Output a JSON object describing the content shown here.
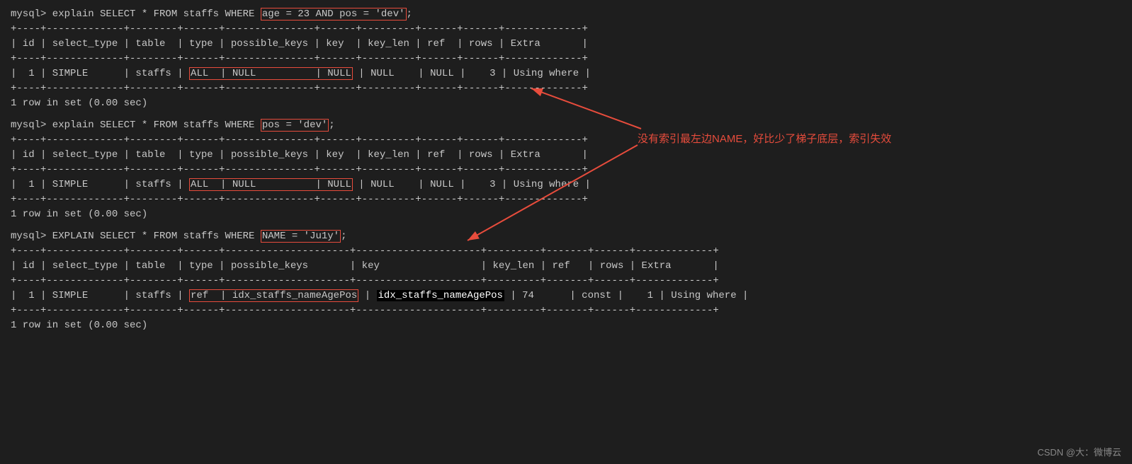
{
  "terminal": {
    "bg": "#1e1e1e",
    "text_color": "#c8c8c8"
  },
  "blocks": [
    {
      "id": "block1",
      "command": "mysql> explain SELECT * FROM staffs WHERE ",
      "highlight_condition": "age = 23 AND pos = 'dev'",
      "highlight_suffix": ";"
    },
    {
      "id": "block2",
      "command": "mysql> explain SELECT * FROM staffs WHERE ",
      "highlight_condition": "pos = 'dev'",
      "highlight_suffix": ";"
    },
    {
      "id": "block3",
      "command": "mysql> EXPLAIN SELECT * FROM staffs WHERE ",
      "highlight_condition": "NAME = 'Ju1y'",
      "highlight_suffix": ";"
    }
  ],
  "annotation": {
    "text": "没有索引最左边NAME，好比少了梯子底层，索引失效",
    "color": "#e74c3c"
  },
  "table1": {
    "divider": "+----+-------------+--------+------+---------------+------+---------+------+------+-------------+",
    "header": "| id | select_type | table  | type | possible_keys | key  | key_len | ref  | rows | Extra       |",
    "row": "|  1 | SIMPLE      | staffs | ALL  | NULL          | NULL | NULL    | NULL |    3 | Using where |",
    "highlight_type": "ALL",
    "highlight_keys": "NULL",
    "highlight_key": "NULL"
  },
  "table2": {
    "divider": "+----+-------------+--------+------+---------------+------+---------+------+------+-------------+",
    "header": "| id | select_type | table  | type | possible_keys | key  | key_len | ref  | rows | Extra       |",
    "row": "|  1 | SIMPLE      | staffs | ALL  | NULL          | NULL | NULL    | NULL |    3 | Using where |",
    "highlight_type": "ALL",
    "highlight_keys": "NULL",
    "highlight_key": "NULL"
  },
  "table3": {
    "divider_top": "+----+-------------+--------+------+--------------------+--------------------+---------+-------+------+-------------+",
    "header": "| id | select_type | table  | type | possible_keys      | key                | key_len | ref   | rows | Extra       |",
    "divider_mid": "+----+-------------+--------+------+--------------------+--------------------+---------+-------+------+-------------+",
    "row_prefix": "|  1 | SIMPLE      | staffs | ref  | idx_staffs_nameAgePos | ",
    "row_key_black": "idx_staffs_nameAgePos",
    "row_suffix": " | 74      | const |    1 | Using where |",
    "divider_bot": "+----+-------------+--------+------+--------------------+--------------------+---------+-------+------+-------------+"
  },
  "row_in_set": "1 row in set (0.00 sec)",
  "watermark": "CSDN @大：微博云"
}
